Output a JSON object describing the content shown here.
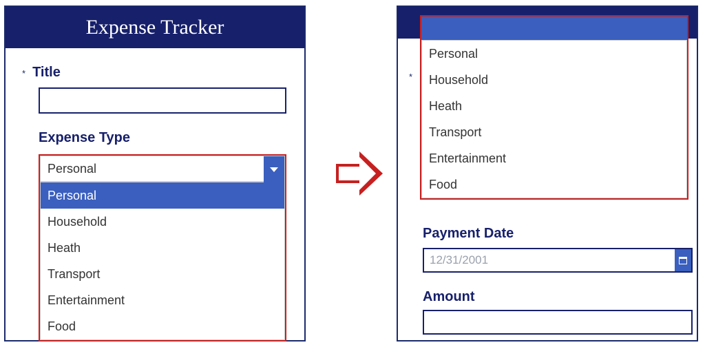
{
  "app": {
    "title": "Expense Tracker"
  },
  "left": {
    "title_label": "Title",
    "expense_type_label": "Expense Type",
    "combo_selected": "Personal",
    "options": [
      "Personal",
      "Household",
      "Heath",
      "Transport",
      "Entertainment",
      "Food"
    ]
  },
  "right": {
    "options": [
      "Personal",
      "Household",
      "Heath",
      "Transport",
      "Entertainment",
      "Food"
    ],
    "payment_date_label": "Payment Date",
    "payment_date_placeholder": "12/31/2001",
    "amount_label": "Amount"
  }
}
